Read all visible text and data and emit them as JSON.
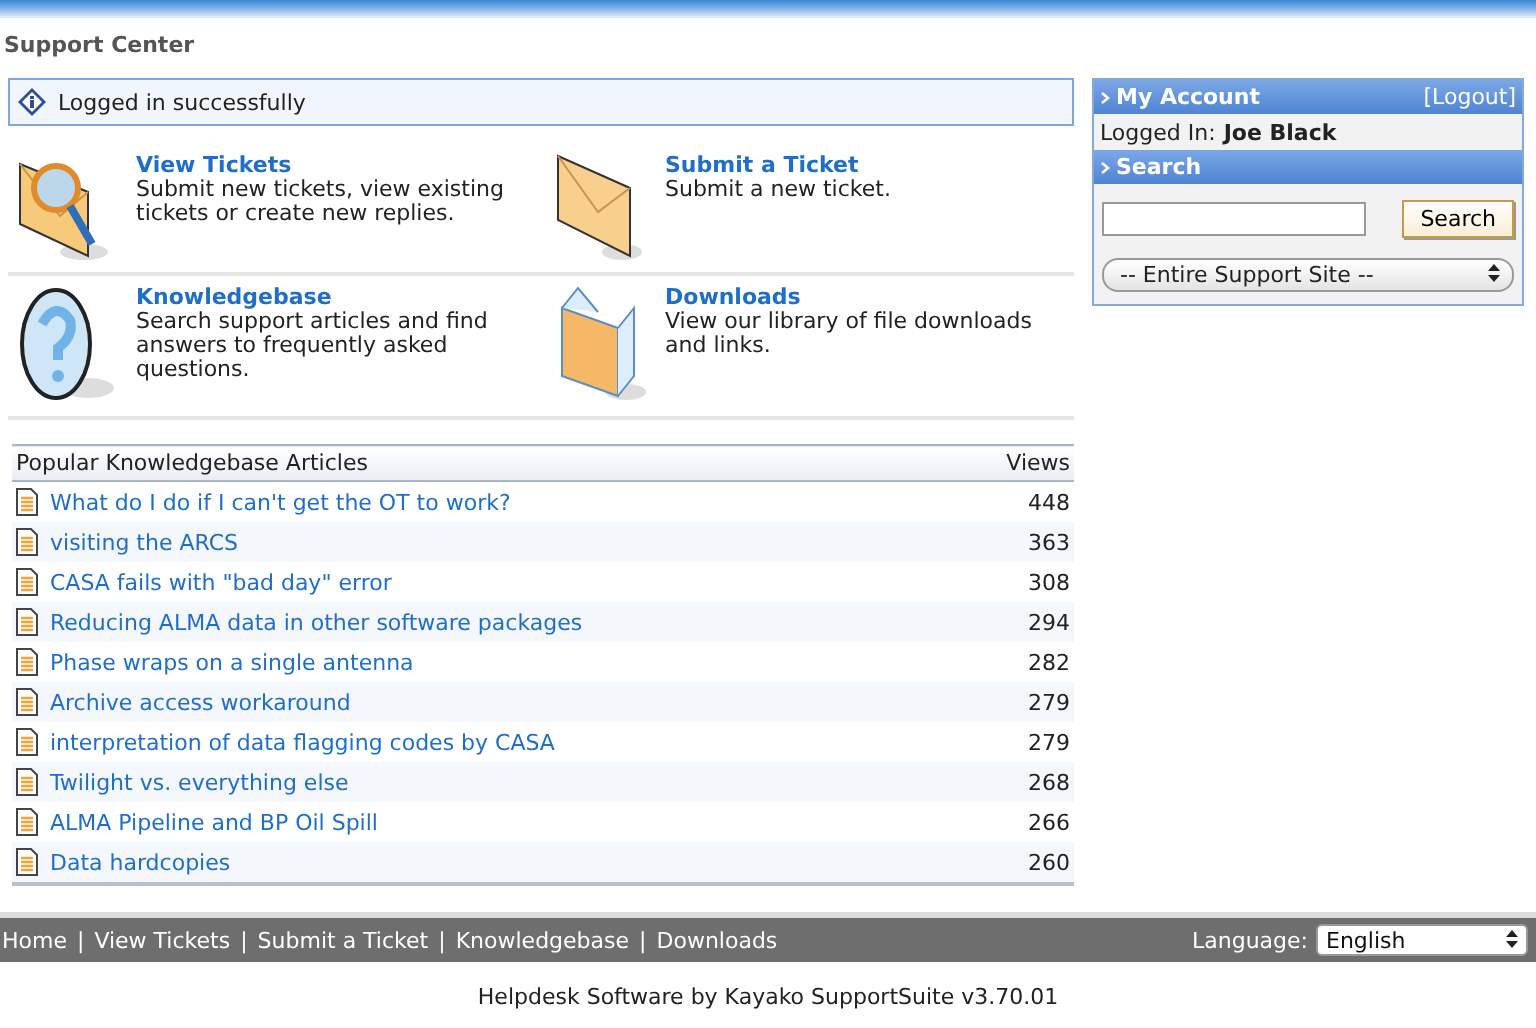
{
  "header": {
    "title": "Support Center"
  },
  "notice": {
    "text": "Logged in successfully"
  },
  "sections": [
    {
      "kind": "view",
      "title": "View Tickets",
      "description": "Submit new tickets, view existing tickets or create new replies."
    },
    {
      "kind": "submit",
      "title": "Submit a Ticket",
      "description": "Submit a new ticket."
    },
    {
      "kind": "knowledgebase",
      "title": "Knowledgebase",
      "description": "Search support articles and find answers to frequently asked questions."
    },
    {
      "kind": "downloads",
      "title": "Downloads",
      "description": "View our library of file downloads and links."
    }
  ],
  "articles": {
    "columns": [
      "Popular Knowledgebase Articles",
      "Views"
    ],
    "rows": [
      {
        "title": "What do I do if I can't get the OT to work?",
        "views": "448"
      },
      {
        "title": "visiting the ARCS",
        "views": "363"
      },
      {
        "title": "CASA fails with \"bad day\" error",
        "views": "308"
      },
      {
        "title": "Reducing ALMA data in other software packages",
        "views": "294"
      },
      {
        "title": "Phase wraps on a single antenna",
        "views": "282"
      },
      {
        "title": "Archive access workaround",
        "views": "279"
      },
      {
        "title": "interpretation of data flagging codes by CASA",
        "views": "279"
      },
      {
        "title": "Twilight vs. everything else",
        "views": "268"
      },
      {
        "title": "ALMA Pipeline and BP Oil Spill",
        "views": "266"
      },
      {
        "title": "Data hardcopies",
        "views": "260"
      }
    ]
  },
  "account": {
    "title": "My Account",
    "logout": "[Logout]",
    "label": "Logged In:",
    "user": "Joe Black"
  },
  "search": {
    "title": "Search",
    "button": "Search",
    "scope": "-- Entire Support Site --"
  },
  "footer": {
    "links": [
      "Home",
      "View Tickets",
      "Submit a Ticket",
      "Knowledgebase",
      "Downloads"
    ],
    "separator": "|",
    "language_label": "Language:",
    "language": "English"
  },
  "credit": "Helpdesk Software by Kayako SupportSuite v3.70.01"
}
